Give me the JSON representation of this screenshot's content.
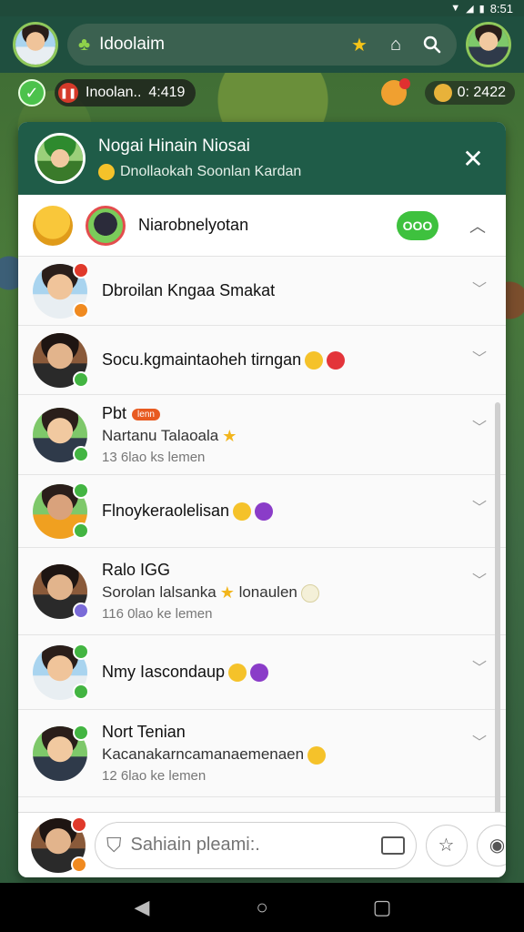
{
  "status_bar": {
    "time": "8:51"
  },
  "top_bar": {
    "app_title": "Idoolaim",
    "icons": [
      "leaf-icon",
      "star-icon",
      "home-icon",
      "search-icon"
    ]
  },
  "hud": {
    "player_label": "Inoolan..",
    "player_value": "4:419",
    "coins": "0: 2422",
    "colors": {
      "leaf": "#4cc24c",
      "pause": "#d53a2a"
    }
  },
  "panel": {
    "title": "Nogai Hinain Niosai",
    "subtitle": "Dnollaokah Soonlan Kardan",
    "close_icon": "close-icon",
    "accent": "#1f5c48"
  },
  "featured": {
    "name": "Niarobnelyotan",
    "toggle_label": "OOO"
  },
  "chats": [
    {
      "name": "Dbroilan Kngaa Smakat",
      "message": "",
      "time": "",
      "tag": "",
      "emojis": [],
      "badge": "red",
      "badge_pos": "tr",
      "badge2": "orange"
    },
    {
      "name": "Socu.kgmaintaoheh tirngan",
      "message": "",
      "time": "",
      "tag": "",
      "emojis": [
        "laugh",
        "heart"
      ],
      "badge": "green",
      "badge_pos": "br"
    },
    {
      "name": "Pbt",
      "message": "Nartanu Talaoala",
      "time": "13 6lao ks lemen",
      "tag": "lenn",
      "emojis_msg": [
        "star"
      ],
      "badge": "green",
      "badge_pos": "br"
    },
    {
      "name": "Flnoykeraolelisan",
      "message": "",
      "time": "",
      "tag": "",
      "emojis": [
        "laugh",
        "devil"
      ],
      "badge": "green",
      "badge_pos": "tr",
      "badge2": "green"
    },
    {
      "name": "Ralo IGG",
      "message": "Sorolan lalsanka",
      "message2": "lonaulen",
      "time": "116 0lao ke lemen",
      "tag": "",
      "emojis_msg": [
        "star"
      ],
      "badge": "purple",
      "badge_pos": "br"
    },
    {
      "name": "Nmy Iascondaup",
      "message": "",
      "time": "",
      "tag": "",
      "emojis": [
        "laugh",
        "devil"
      ],
      "badge": "green",
      "badge_pos": "tr",
      "badge2": "green"
    },
    {
      "name": "Nort Tenian",
      "message": "Kacanakarncamanaemenaen",
      "time": "12 6lao ke lemen",
      "tag": "",
      "emojis_msg": [
        "laugh"
      ],
      "badge": "green",
      "badge_pos": "tr"
    }
  ],
  "composer": {
    "placeholder": "Sahiain pleami:.",
    "icons": [
      "shield-icon",
      "card-icon",
      "star-outline-icon",
      "record-icon"
    ]
  },
  "nav_bar": {
    "icons": [
      "back-icon",
      "home-circle-icon",
      "recents-icon"
    ]
  }
}
